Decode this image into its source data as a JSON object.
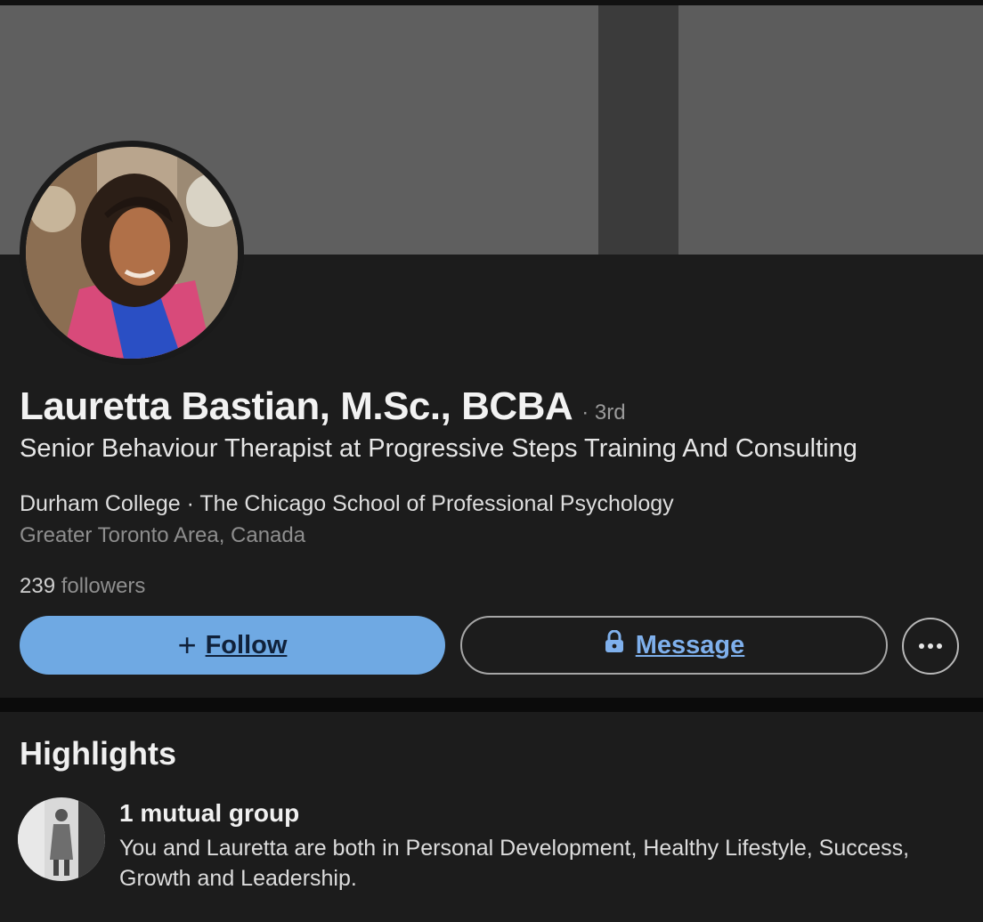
{
  "profile": {
    "name": "Lauretta Bastian, M.Sc., BCBA",
    "degree": "· 3rd",
    "headline": "Senior Behaviour Therapist at Progressive Steps Training And Consulting",
    "education": "Durham College · The Chicago School of Professional Psychology",
    "location": "Greater Toronto Area, Canada",
    "followers_count": "239",
    "followers_label": "followers"
  },
  "actions": {
    "follow_icon": "+",
    "follow_label": "Follow",
    "message_label": "Message",
    "message_icon": "lock-icon",
    "more_icon": "more-icon"
  },
  "highlights": {
    "title": "Highlights",
    "group_title": "1 mutual group",
    "group_description": "You and Lauretta are both in Personal Development, Healthy Lifestyle, Success, Growth and Leadership."
  },
  "colors": {
    "follow_button": "#6fa9e3",
    "message_text": "#7fb0ec",
    "card_background": "#1c1c1c"
  }
}
